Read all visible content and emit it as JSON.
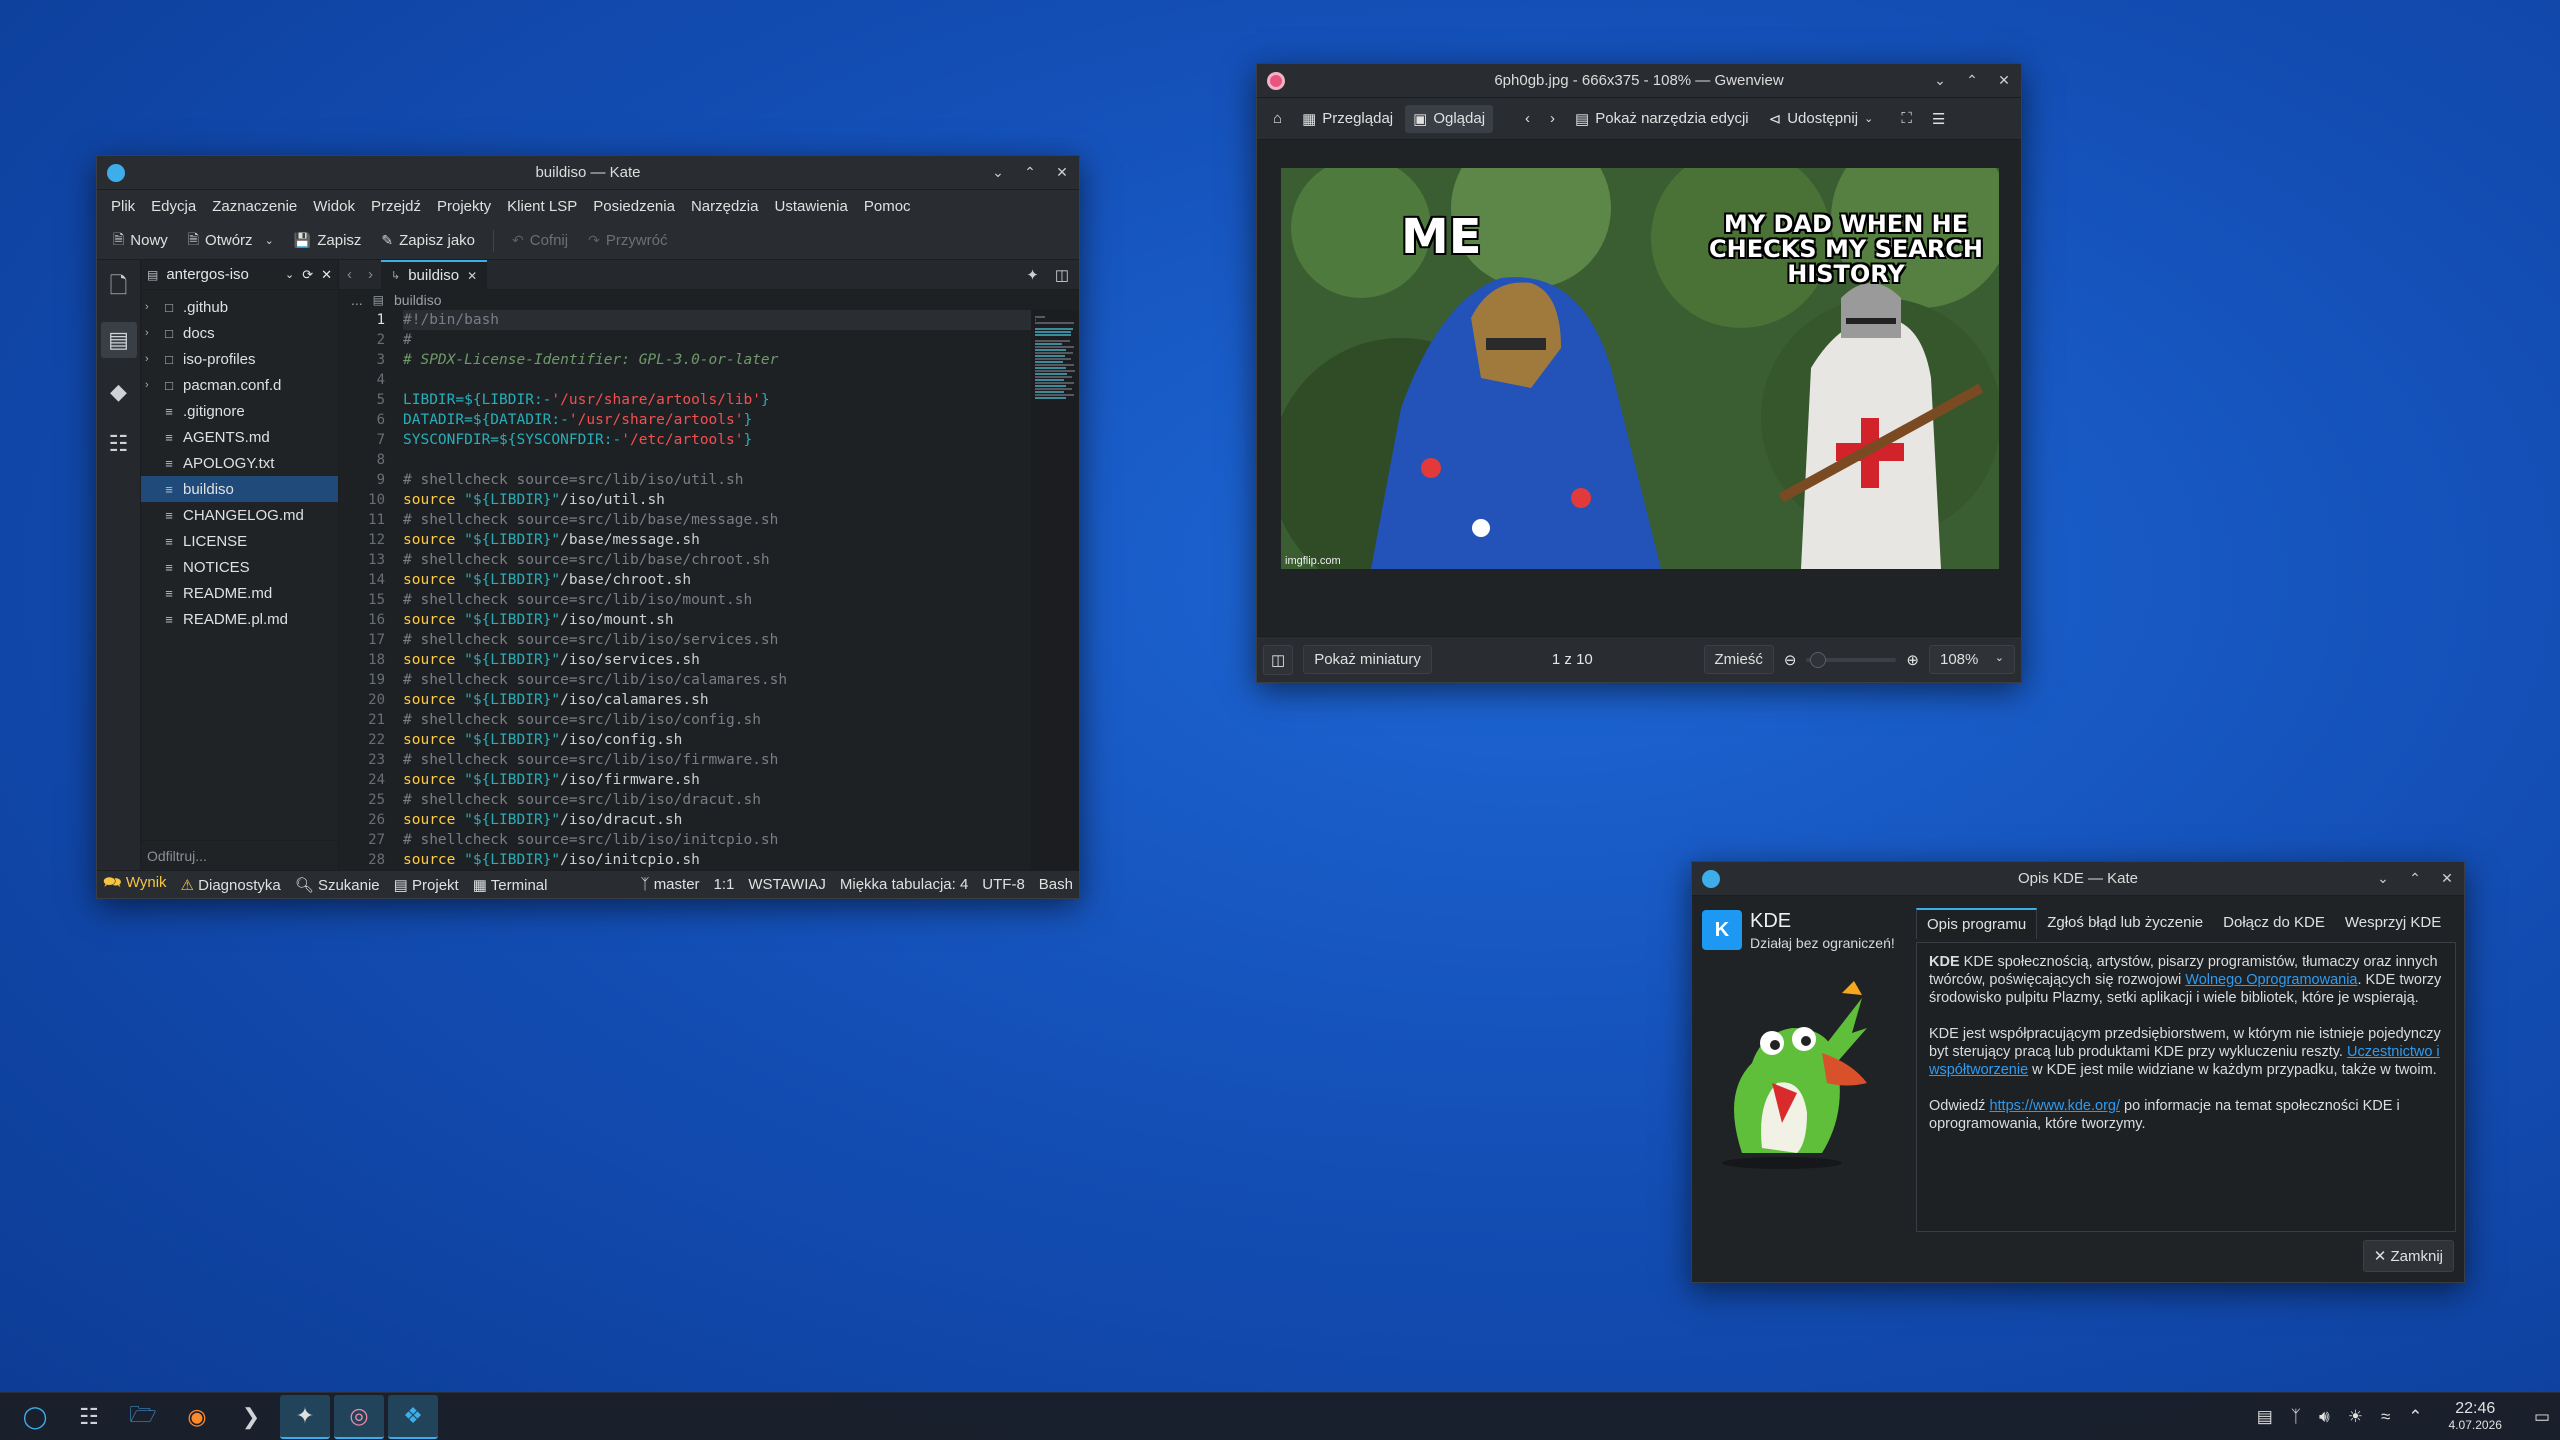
{
  "kate": {
    "title": "buildiso — Kate",
    "menu": [
      "Plik",
      "Edycja",
      "Zaznaczenie",
      "Widok",
      "Przejdź",
      "Projekty",
      "Klient LSP",
      "Posiedzenia",
      "Narzędzia",
      "Ustawienia",
      "Pomoc"
    ],
    "toolbar": {
      "new": "Nowy",
      "open": "Otwórz",
      "save": "Zapisz",
      "save_as": "Zapisz jako",
      "undo": "Cofnij",
      "redo": "Przywróć"
    },
    "project": "antergos-iso",
    "filter_placeholder": "Odfiltruj...",
    "files": [
      {
        "name": ".github",
        "folder": true
      },
      {
        "name": "docs",
        "folder": true
      },
      {
        "name": "iso-profiles",
        "folder": true
      },
      {
        "name": "pacman.conf.d",
        "folder": true
      },
      {
        "name": ".gitignore",
        "folder": false
      },
      {
        "name": "AGENTS.md",
        "folder": false
      },
      {
        "name": "APOLOGY.txt",
        "folder": false
      },
      {
        "name": "buildiso",
        "folder": false,
        "selected": true
      },
      {
        "name": "CHANGELOG.md",
        "folder": false
      },
      {
        "name": "LICENSE",
        "folder": false
      },
      {
        "name": "NOTICES",
        "folder": false
      },
      {
        "name": "README.md",
        "folder": false
      },
      {
        "name": "README.pl.md",
        "folder": false
      }
    ],
    "tab": "buildiso",
    "breadcrumb": "buildiso",
    "breadcrumb_prefix": "...",
    "code": [
      "#!/bin/bash",
      "#",
      "# SPDX-License-Identifier: GPL-3.0-or-later",
      "",
      "LIBDIR=${LIBDIR:-'/usr/share/artools/lib'}",
      "DATADIR=${DATADIR:-'/usr/share/artools'}",
      "SYSCONFDIR=${SYSCONFDIR:-'/etc/artools'}",
      "",
      "# shellcheck source=src/lib/iso/util.sh",
      "source \"${LIBDIR}\"/iso/util.sh",
      "# shellcheck source=src/lib/base/message.sh",
      "source \"${LIBDIR}\"/base/message.sh",
      "# shellcheck source=src/lib/base/chroot.sh",
      "source \"${LIBDIR}\"/base/chroot.sh",
      "# shellcheck source=src/lib/iso/mount.sh",
      "source \"${LIBDIR}\"/iso/mount.sh",
      "# shellcheck source=src/lib/iso/services.sh",
      "source \"${LIBDIR}\"/iso/services.sh",
      "# shellcheck source=src/lib/iso/calamares.sh",
      "source \"${LIBDIR}\"/iso/calamares.sh",
      "# shellcheck source=src/lib/iso/config.sh",
      "source \"${LIBDIR}\"/iso/config.sh",
      "# shellcheck source=src/lib/iso/firmware.sh",
      "source \"${LIBDIR}\"/iso/firmware.sh",
      "# shellcheck source=src/lib/iso/dracut.sh",
      "source \"${LIBDIR}\"/iso/dracut.sh",
      "# shellcheck source=src/lib/iso/initcpio.sh",
      "source \"${LIBDIR}\"/iso/initcpio.sh"
    ],
    "status": {
      "output": "Wynik",
      "diagnostics": "Diagnostyka",
      "search": "Szukanie",
      "project": "Projekt",
      "terminal": "Terminal",
      "branch": "master",
      "position": "1:1",
      "mode": "WSTAWIAJ",
      "indent": "Miękka tabulacja: 4",
      "encoding": "UTF-8",
      "language": "Bash"
    }
  },
  "gwenview": {
    "title": "6ph0gb.jpg - 666x375 - 108% — Gwenview",
    "browse": "Przeglądaj",
    "view": "Oglądaj",
    "edit_tools": "Pokaż narzędzia edycji",
    "share": "Udostępnij",
    "meme_left": "ME",
    "meme_right": "MY DAD WHEN HE CHECKS MY SEARCH HISTORY",
    "watermark": "imgflip.com",
    "thumbnails": "Pokaż miniatury",
    "counter": "1 z 10",
    "fit": "Zmieść",
    "zoom": "108%",
    "zoom_level": 0.05
  },
  "about": {
    "title": "Opis KDE — Kate",
    "name": "KDE",
    "slogan": "Działaj bez ograniczeń!",
    "tabs": [
      "Opis programu",
      "Zgłoś błąd lub życzenie",
      "Dołącz do KDE",
      "Wesprzyj KDE"
    ],
    "p1_bold": "KDE",
    "p1_a": " KDE społecznością, artystów, pisarzy programistów, tłumaczy oraz innych twórców, poświęcających się rozwojowi ",
    "p1_link": "Wolnego Oprogramowania",
    "p1_b": ". KDE tworzy środowisko pulpitu Plazmy, setki aplikacji i wiele bibliotek, które je wspierają.",
    "p2_a": "KDE jest współpracującym przedsiębiorstwem, w którym nie istnieje pojedynczy byt sterujący pracą lub produktami KDE przy wykluczeniu reszty. ",
    "p2_link": "Uczestnictwo i współtworzenie",
    "p2_b": " w KDE jest mile widziane w każdym przypadku, także w twoim.",
    "p3_a": "Odwiedź ",
    "p3_link": "https://www.kde.org/",
    "p3_b": " po informacje na temat społeczności KDE i oprogramowania, które tworzymy.",
    "close": "Zamknij"
  },
  "taskbar": {
    "time": "22:46",
    "date": "4.07.2026"
  },
  "colors": {
    "accent": "#3daee9",
    "selection": "#1f4a7a",
    "link": "#2e9bf0"
  }
}
